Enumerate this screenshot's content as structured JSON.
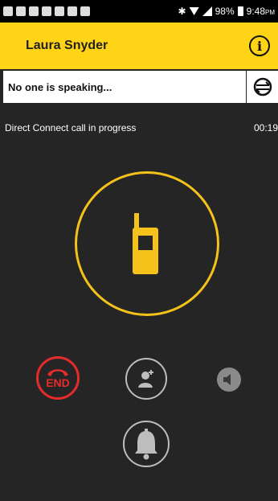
{
  "status_bar": {
    "battery": "98%",
    "time": "9:48",
    "ampm": "PM"
  },
  "header": {
    "contact_name": "Laura Snyder",
    "info_icon": "info-icon"
  },
  "speaking_bar": {
    "text": "No one is speaking...",
    "icon": "refresh-icon"
  },
  "call_status": {
    "text": "Direct Connect call in progress",
    "timer": "00:19"
  },
  "colors": {
    "accent": "#ffd416",
    "ring": "#f4c21a",
    "end": "#e62b2b",
    "background": "#252525",
    "control_gray": "#bdbdbd"
  },
  "controls": {
    "end_label": "END",
    "add_icon": "add-participant-icon",
    "speaker_icon": "speaker-icon",
    "alert_icon": "bell-alert-icon"
  }
}
